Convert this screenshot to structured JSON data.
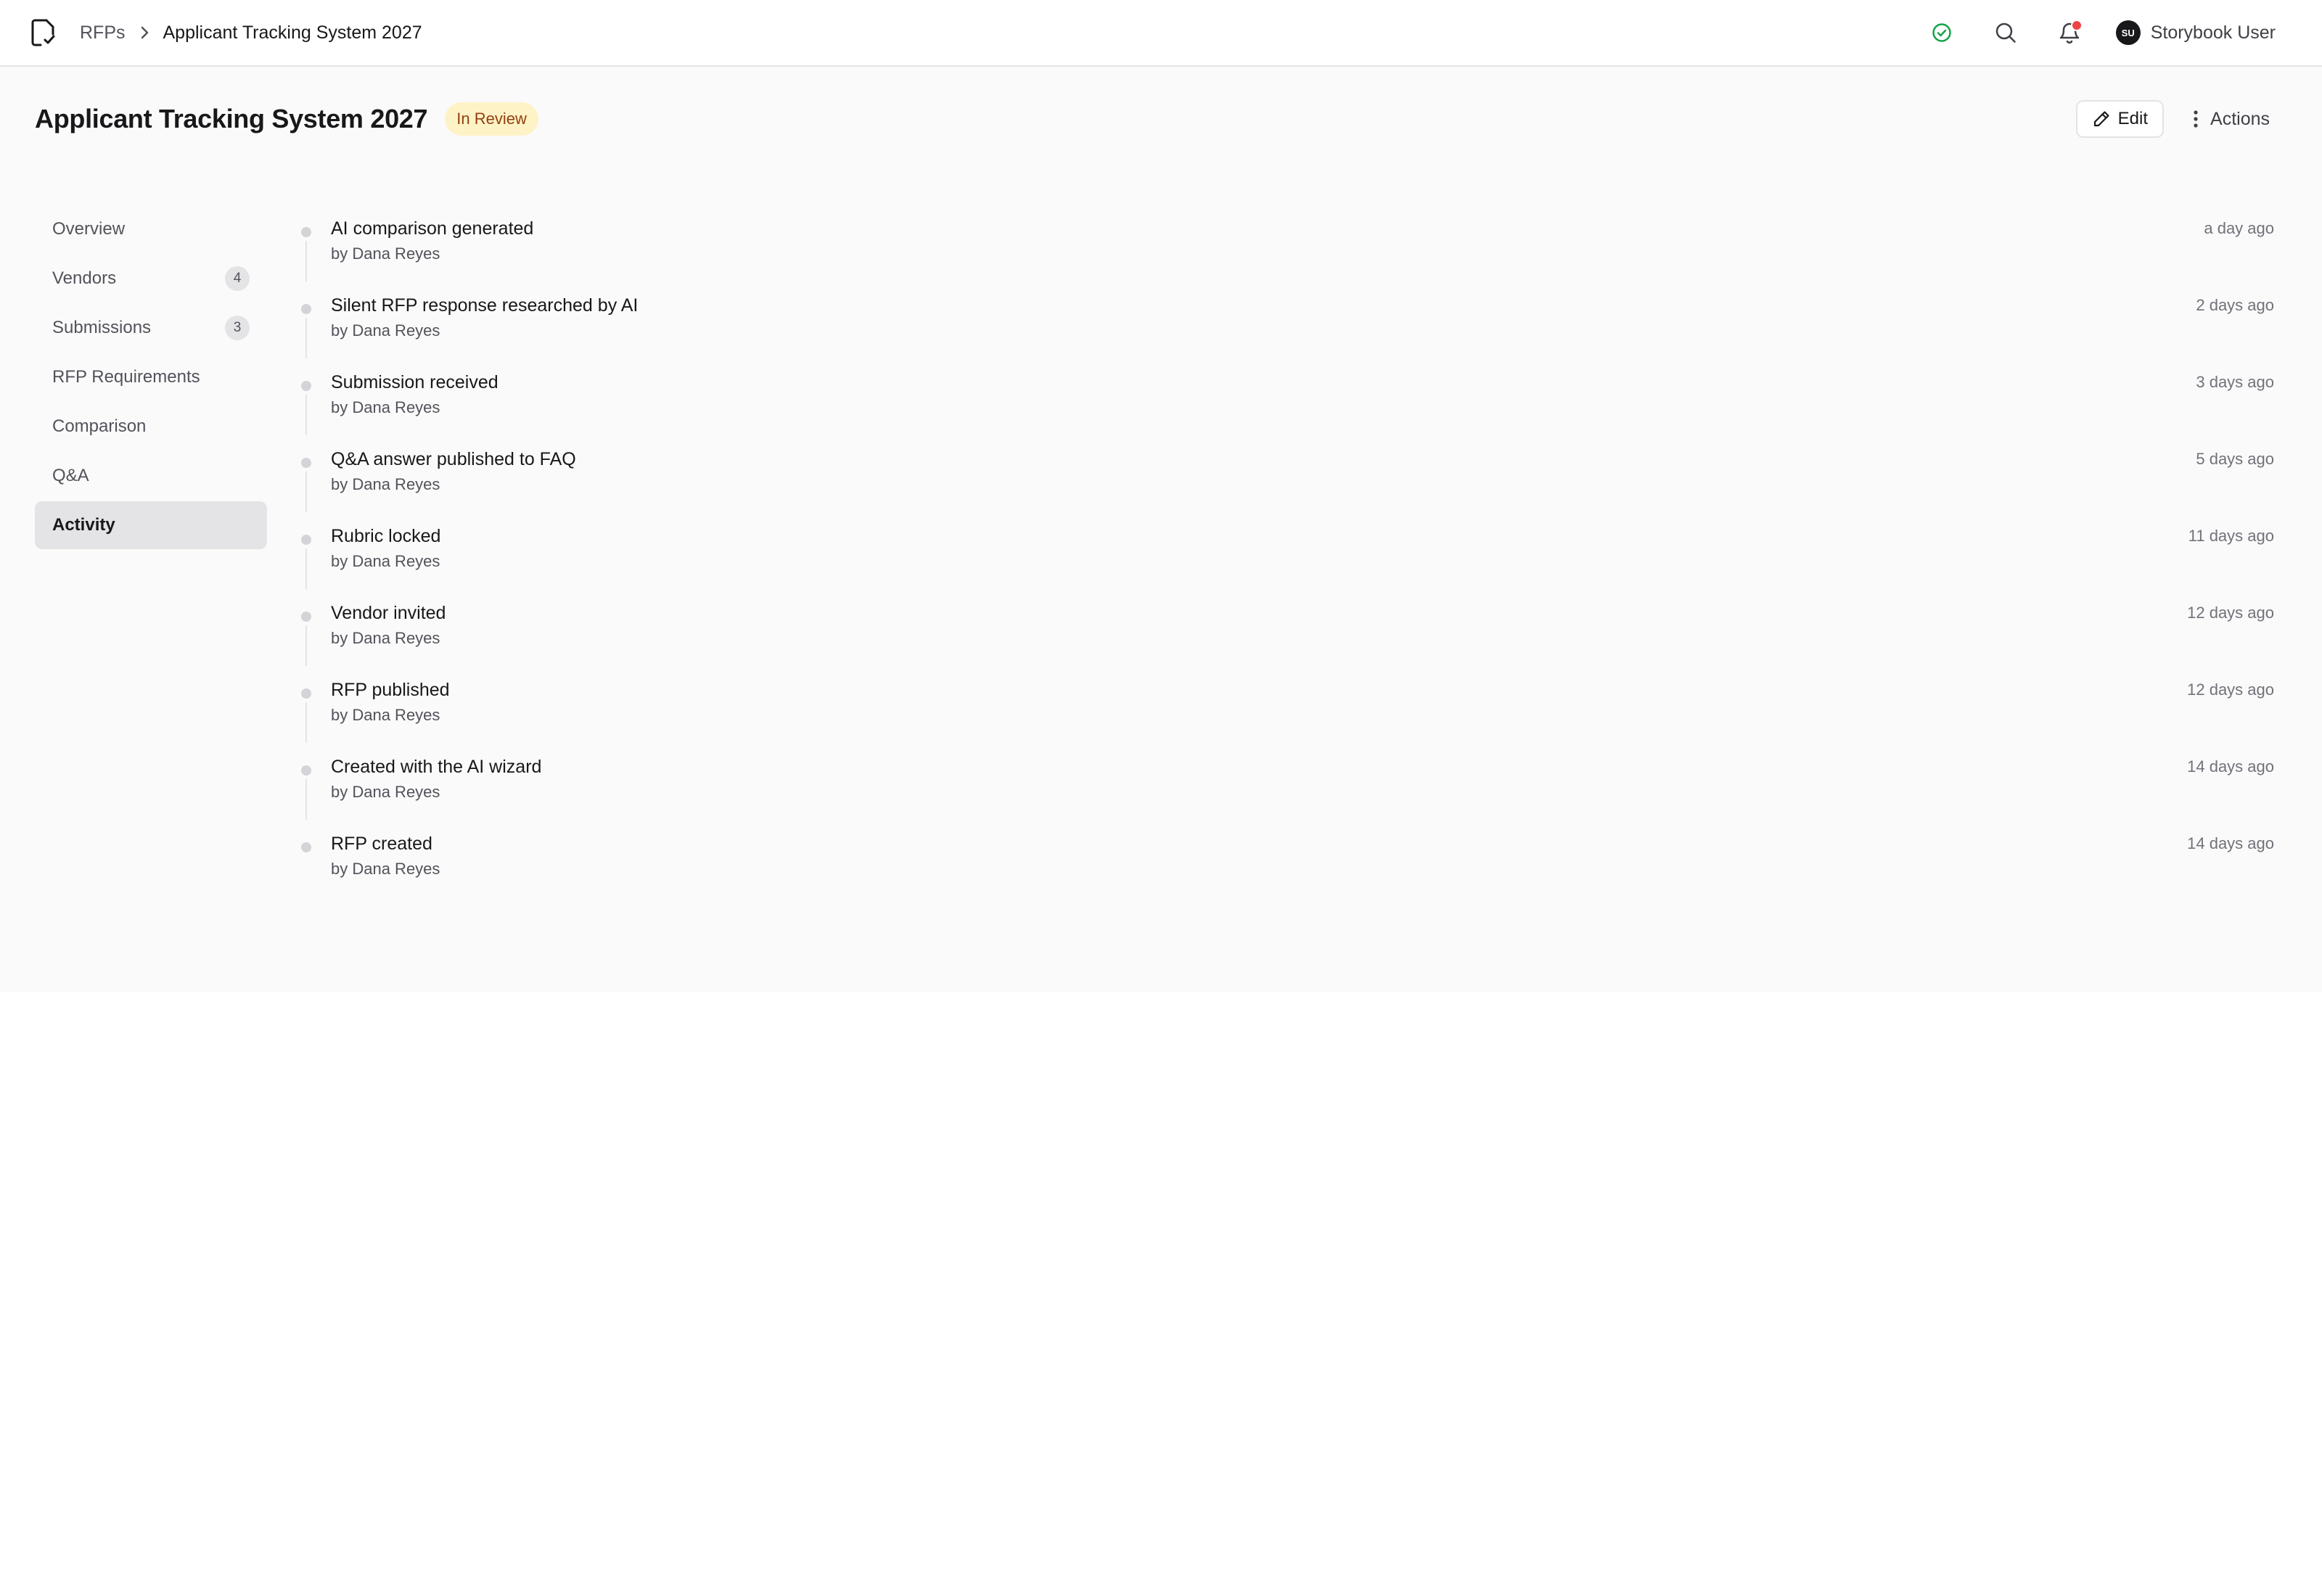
{
  "breadcrumb": {
    "root": "RFPs",
    "current": "Applicant Tracking System 2027"
  },
  "topbar": {
    "icons": [
      "file-check-icon",
      "check-circle-icon",
      "search-icon",
      "bell-icon"
    ],
    "user": {
      "initials": "SU",
      "name": "Storybook User"
    }
  },
  "page": {
    "title": "Applicant Tracking System 2027",
    "status": "In Review",
    "edit_label": "Edit",
    "actions_label": "Actions"
  },
  "colors": {
    "accent_success": "#16a34a",
    "notification": "#ef4444",
    "badge_bg": "#fef3c7",
    "badge_text": "#92400e"
  },
  "nav": [
    {
      "label": "Overview",
      "count": ""
    },
    {
      "label": "Vendors",
      "count": "4"
    },
    {
      "label": "Submissions",
      "count": "3"
    },
    {
      "label": "RFP Requirements",
      "count": ""
    },
    {
      "label": "Comparison",
      "count": ""
    },
    {
      "label": "Q&A",
      "count": ""
    },
    {
      "label": "Activity",
      "count": "",
      "active": true
    }
  ],
  "activity": [
    {
      "title": "AI comparison generated",
      "by": "by Dana Reyes",
      "time": "a day ago"
    },
    {
      "title": "Silent RFP response researched by AI",
      "by": "by Dana Reyes",
      "time": "2 days ago"
    },
    {
      "title": "Submission received",
      "by": "by Dana Reyes",
      "time": "3 days ago"
    },
    {
      "title": "Q&A answer published to FAQ",
      "by": "by Dana Reyes",
      "time": "5 days ago"
    },
    {
      "title": "Rubric locked",
      "by": "by Dana Reyes",
      "time": "11 days ago"
    },
    {
      "title": "Vendor invited",
      "by": "by Dana Reyes",
      "time": "12 days ago"
    },
    {
      "title": "RFP published",
      "by": "by Dana Reyes",
      "time": "12 days ago"
    },
    {
      "title": "Created with the AI wizard",
      "by": "by Dana Reyes",
      "time": "14 days ago"
    },
    {
      "title": "RFP created",
      "by": "by Dana Reyes",
      "time": "14 days ago"
    }
  ]
}
